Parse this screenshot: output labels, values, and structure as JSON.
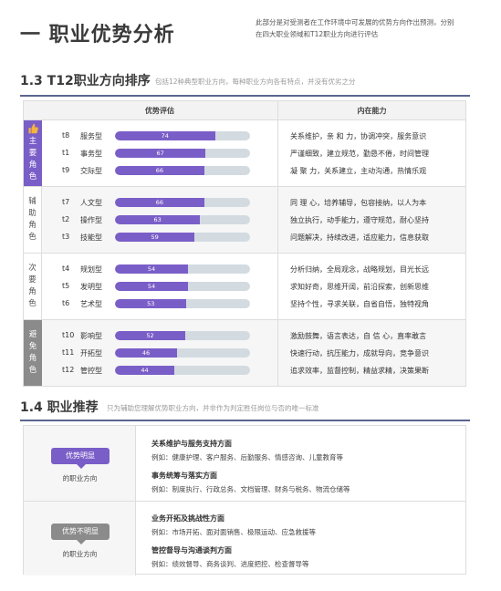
{
  "header": {
    "title": "一 职业优势分析",
    "desc_line1": "此部分是对受测者在工作环境中可发展的优势方向作出预测，分别",
    "desc_line2": "在四大职业领域和T12职业方向进行评估"
  },
  "section13": {
    "title": "1.3 T12职业方向排序",
    "subtitle": "包括12种典型职业方向，每种职业方向各有特点，并没有优劣之分",
    "col_left": "优势评估",
    "col_right": "内在能力"
  },
  "groups": [
    {
      "label": [
        "主",
        "要",
        "角",
        "色"
      ],
      "rows": [
        {
          "code": "t8",
          "name": "服务型",
          "score": "74",
          "value": 74
        },
        {
          "code": "t1",
          "name": "事务型",
          "score": "67",
          "value": 67
        },
        {
          "code": "t9",
          "name": "交际型",
          "score": "66",
          "value": 66
        }
      ],
      "abilities": [
        "关系维护，亲 和 力，协调冲突，服务意识",
        "严谨细致，建立规范，勤恳不倦，时间管理",
        "凝 聚 力，关系建立，主动沟通，热情乐观"
      ]
    },
    {
      "label": [
        "辅",
        "助",
        "角",
        "色"
      ],
      "rows": [
        {
          "code": "t7",
          "name": "人文型",
          "score": "66",
          "value": 66
        },
        {
          "code": "t2",
          "name": "操作型",
          "score": "63",
          "value": 63
        },
        {
          "code": "t3",
          "name": "技能型",
          "score": "59",
          "value": 59
        }
      ],
      "abilities": [
        "同 理 心，培养辅导，包容接纳，以人为本",
        "独立执行，动手能力，遵守规范，耐心坚持",
        "问题解决，持续改进，适应能力，信息获取"
      ]
    },
    {
      "label": [
        "次",
        "要",
        "角",
        "色"
      ],
      "rows": [
        {
          "code": "t4",
          "name": "规划型",
          "score": "54",
          "value": 54
        },
        {
          "code": "t5",
          "name": "发明型",
          "score": "54",
          "value": 54
        },
        {
          "code": "t6",
          "name": "艺术型",
          "score": "53",
          "value": 53
        }
      ],
      "abilities": [
        "分析归纳，全局观念，战略规划，目光长远",
        "求知好奇，思维开阔，前沿探索，创新思维",
        "坚持个性，寻求关联，自省自悟，独特视角"
      ]
    },
    {
      "label": [
        "避",
        "免",
        "角",
        "色"
      ],
      "rows": [
        {
          "code": "t10",
          "name": "影响型",
          "score": "52",
          "value": 52
        },
        {
          "code": "t11",
          "name": "开拓型",
          "score": "46",
          "value": 46
        },
        {
          "code": "t12",
          "name": "管控型",
          "score": "44",
          "value": 44
        }
      ],
      "abilities": [
        "激励鼓舞，语言表达，自 信 心，直率敢言",
        "快速行动，抗压能力，成就导向，竞争意识",
        "追求效率，监督控制，精益求精，决策果断"
      ]
    }
  ],
  "section14": {
    "title": "1.4 职业推荐",
    "subtitle": "只为辅助您理解优势职业方向，并非作为判定胜任岗位与否的唯一标准"
  },
  "recommend": [
    {
      "badge": "优势明显",
      "sub": "的职业方向",
      "items": [
        {
          "heading": "关系维护与服务支持方面",
          "text": "例如：健康护理、客户服务、后勤服务、情感咨询、儿童教育等"
        },
        {
          "heading": "事务统筹与落实方面",
          "text": "例如：制度执行、行政总务、文档管理、财务与税务、物流仓储等"
        }
      ]
    },
    {
      "badge": "优势不明显",
      "sub": "的职业方向",
      "items": [
        {
          "heading": "业务开拓及挑战性方面",
          "text": "例如：市场开拓、面对面销售、极限运动、应急救援等"
        },
        {
          "heading": "管控督导与沟通谈判方面",
          "text": "例如：绩效督导、商务谈判、进度把控、检查督导等"
        }
      ]
    }
  ],
  "colors": {
    "accent": "#7a5ec8",
    "gray_badge": "#8b8b8b",
    "track": "#d3dbe1",
    "rule": "#5a6690"
  },
  "icons": {
    "main_role_icon": "thumbs-up-icon"
  }
}
